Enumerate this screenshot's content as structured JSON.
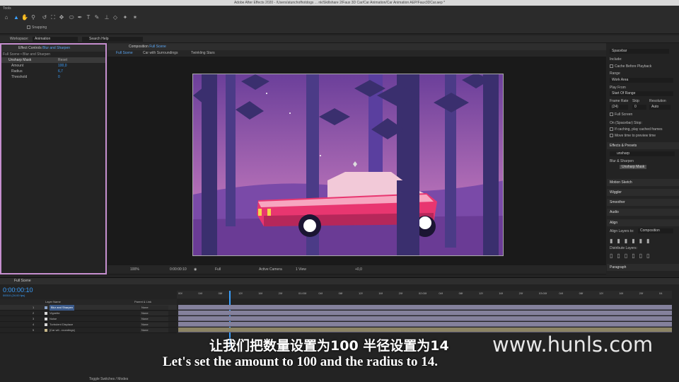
{
  "window": {
    "title": "Adobe After Effects 2020 - /Users/atunchofhotdogs ... nk/Skillshare 2/Faux 3D Car/Car Animation/Car Animation AEP/Faux3DCar.aep *"
  },
  "tools": {
    "panel_label": "Tools",
    "snapping_label": "Snapping"
  },
  "workspace": {
    "label": "Workspace:",
    "value": "Animation",
    "search_placeholder": "Search Help"
  },
  "effect_controls": {
    "title_prefix": "Effect Controls",
    "title_layer": "Blur and Sharpen",
    "subtitle": "Full Scene • Blur and Sharpen",
    "effect": {
      "name": "Unsharp Mask",
      "reset": "Reset"
    },
    "params": [
      {
        "name": "Amount",
        "value": "100,0"
      },
      {
        "name": "Radius",
        "value": "6,7"
      },
      {
        "name": "Threshold",
        "value": "0"
      }
    ]
  },
  "composition": {
    "title_prefix": "Composition",
    "title_name": "Full Scene",
    "tabs": [
      "Full Scene",
      "Car with Surroundings",
      "Twinkling Stars"
    ],
    "footer": {
      "zoom": "100%",
      "timecode": "0:00:00:10",
      "resolution": "Full",
      "camera": "Active Camera",
      "views": "1 View",
      "exposure": "+0,0"
    }
  },
  "preview_panel": {
    "shortcut": "Spacebar",
    "include_label": "Include:",
    "cache_label": "Cache Before Playback",
    "range_label": "Range",
    "range_value": "Work Area",
    "play_from_label": "Play From",
    "play_from_value": "Start Of Range",
    "frame_rate_label": "Frame Rate",
    "skip_label": "Skip",
    "resolution_label": "Resolution",
    "frame_rate_value": "(24)",
    "skip_value": "0",
    "resolution_value": "Auto",
    "full_screen_label": "Full Screen",
    "on_stop_label": "On (Spacebar) Stop:",
    "if_caching_label": "If caching, play cached frames",
    "move_time_label": "Move time to preview time"
  },
  "effects_presets": {
    "title": "Effects & Presets",
    "search_value": "unsharp",
    "category": "Blur & Sharpen",
    "result": "Unsharp Mask",
    "panels": [
      "Motion Sketch",
      "Wiggler",
      "Smoother",
      "Audio"
    ]
  },
  "align_panel": {
    "title": "Align",
    "align_to_label": "Align Layers to:",
    "align_to_value": "Composition",
    "distribute_label": "Distribute Layers:"
  },
  "paragraph_panel": {
    "title": "Paragraph"
  },
  "timeline": {
    "tab": "Full Scene",
    "timecode": "0:00:00:10",
    "timecode_sub": "00010 (24.00 fps)",
    "columns": {
      "layer_name": "Layer Name",
      "parent": "Parent & Link"
    },
    "layers": [
      {
        "num": "1",
        "name": "Blur and Sharpen",
        "parent": "None",
        "color": "#8aa3c9"
      },
      {
        "num": "2",
        "name": "Vignette",
        "parent": "None",
        "color": "#d8d8d8"
      },
      {
        "num": "3",
        "name": "Noise",
        "parent": "None",
        "color": "#d8d8d8"
      },
      {
        "num": "4",
        "name": "Turbulent Displace",
        "parent": "None",
        "color": "#d8d8d8"
      },
      {
        "num": "5",
        "name": "[Car wit...roundings]",
        "parent": "None",
        "color": "#c9b98a"
      }
    ],
    "ruler_ticks": [
      "00f",
      "04f",
      "08f",
      "12f",
      "16f",
      "20f",
      "01:00f",
      "04f",
      "08f",
      "12f",
      "16f",
      "20f",
      "02:00f",
      "04f",
      "08f",
      "12f",
      "16f",
      "20f",
      "03:00f",
      "04f",
      "08f",
      "12f",
      "16f",
      "20f",
      "04"
    ],
    "toggle_label": "Toggle Switches / Modes"
  },
  "subtitles": {
    "zh": "让我们把数量设置为100 半径设置为14",
    "en": "Let's set the amount to 100 and the radius to 14."
  },
  "watermark": "www.hunls.com",
  "colors": {
    "accent": "#3aa0ff",
    "highlight_border": "#c68fcf",
    "car": "#e83670",
    "sky_top": "#6b3f9a",
    "sky_bottom": "#b771b8",
    "tree": "#3a2f6e",
    "layer_bar": "#84819c"
  }
}
